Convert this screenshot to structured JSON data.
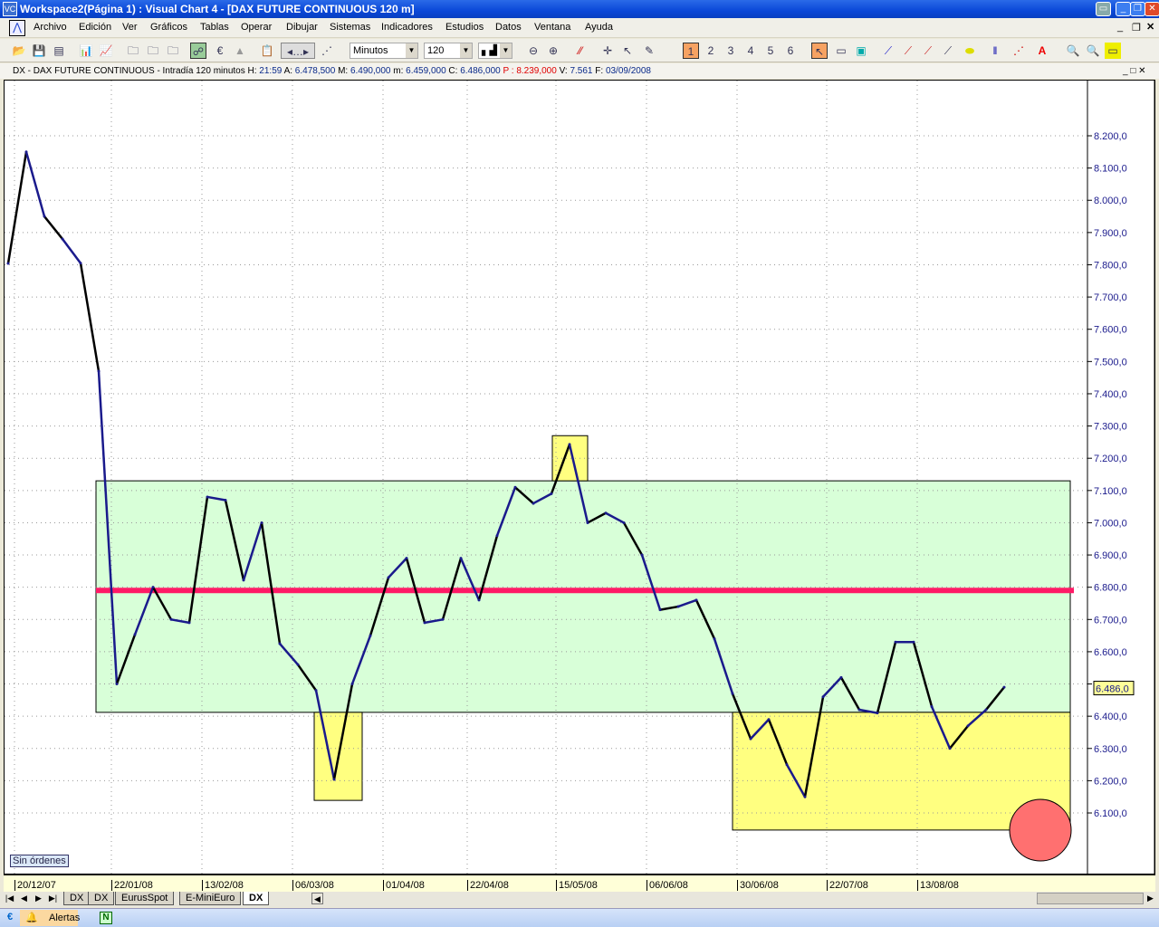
{
  "window": {
    "title": "Workspace2(Página 1) : Visual Chart 4 - [DAX FUTURE CONTINUOUS 120 m]"
  },
  "menu": [
    "Archivo",
    "Edición",
    "Ver",
    "Gráficos",
    "Tablas",
    "Operar",
    "Dibujar",
    "Sistemas",
    "Indicadores",
    "Estudios",
    "Datos",
    "Ventana",
    "Ayuda"
  ],
  "toolbar": {
    "period_unit": "Minutos",
    "period_value": "120"
  },
  "info": {
    "symbol": "DX - DAX FUTURE CONTINUOUS - Intradía 120 minutos",
    "h_label": "H:",
    "h": "21:59",
    "a_label": "A:",
    "a": "6.478,500",
    "m_label": "M:",
    "m": "6.490,000",
    "mi_label": "m:",
    "mi": "6.459,000",
    "c_label": "C:",
    "c": "6.486,000",
    "p_label": "P :",
    "p": "8.239,000",
    "v_label": "V:",
    "v": "7.561",
    "f_label": "F:",
    "f": "03/09/2008"
  },
  "chart_data": {
    "type": "line",
    "ylim": [
      5960,
      8360
    ],
    "y_ticks": [
      "8.200,0",
      "8.100,0",
      "8.000,0",
      "7.900,0",
      "7.800,0",
      "7.700,0",
      "7.600,0",
      "7.500,0",
      "7.400,0",
      "7.300,0",
      "7.200,0",
      "7.100,0",
      "7.000,0",
      "6.900,0",
      "6.800,0",
      "6.700,0",
      "6.600,0",
      "6.500,0",
      "6.400,0",
      "6.300,0",
      "6.200,0",
      "6.100,0"
    ],
    "x_ticks": [
      "20/12/07",
      "22/01/08",
      "13/02/08",
      "06/03/08",
      "01/04/08",
      "22/04/08",
      "15/05/08",
      "06/06/08",
      "30/06/08",
      "22/07/08",
      "13/08/08"
    ],
    "values": [
      7804,
      8150,
      7950,
      7880,
      7805,
      7470,
      6500,
      6653,
      6800,
      6700,
      6690,
      7080,
      7070,
      6822,
      7000,
      6625,
      6560,
      6480,
      6204,
      6500,
      6650,
      6830,
      6890,
      6690,
      6700,
      6890,
      6760,
      6960,
      7110,
      7060,
      7090,
      7243,
      7000,
      7030,
      7000,
      6900,
      6730,
      6740,
      6760,
      6640,
      6470,
      6330,
      6390,
      6250,
      6150,
      6460,
      6520,
      6420,
      6410,
      6630,
      6630,
      6430,
      6300,
      6370,
      6420,
      6490
    ],
    "last_price_label": "6.486,0",
    "horizontal_line": {
      "price": 6790,
      "color": "#ff1a66"
    },
    "zones": [
      {
        "from": 6412,
        "to": 7130,
        "color": "#d8ffd8"
      },
      {
        "from": 6139,
        "to": 6412,
        "color": "#ffff80"
      },
      {
        "from": 7130,
        "to": 7270,
        "color": "#ffff80"
      },
      {
        "from": 6047,
        "to": 6412,
        "color": "#ffff80"
      }
    ],
    "marker_color": "#ff7070",
    "grid": true,
    "series_colors": [
      "#000000",
      "#1a1a8c"
    ]
  },
  "orders_label": "Sin órdenes",
  "tabs": [
    "DX",
    "DX",
    "EurusSpot",
    "E-MiniEuro",
    "DX"
  ],
  "taskbar": {
    "alerts": "Alertas"
  }
}
